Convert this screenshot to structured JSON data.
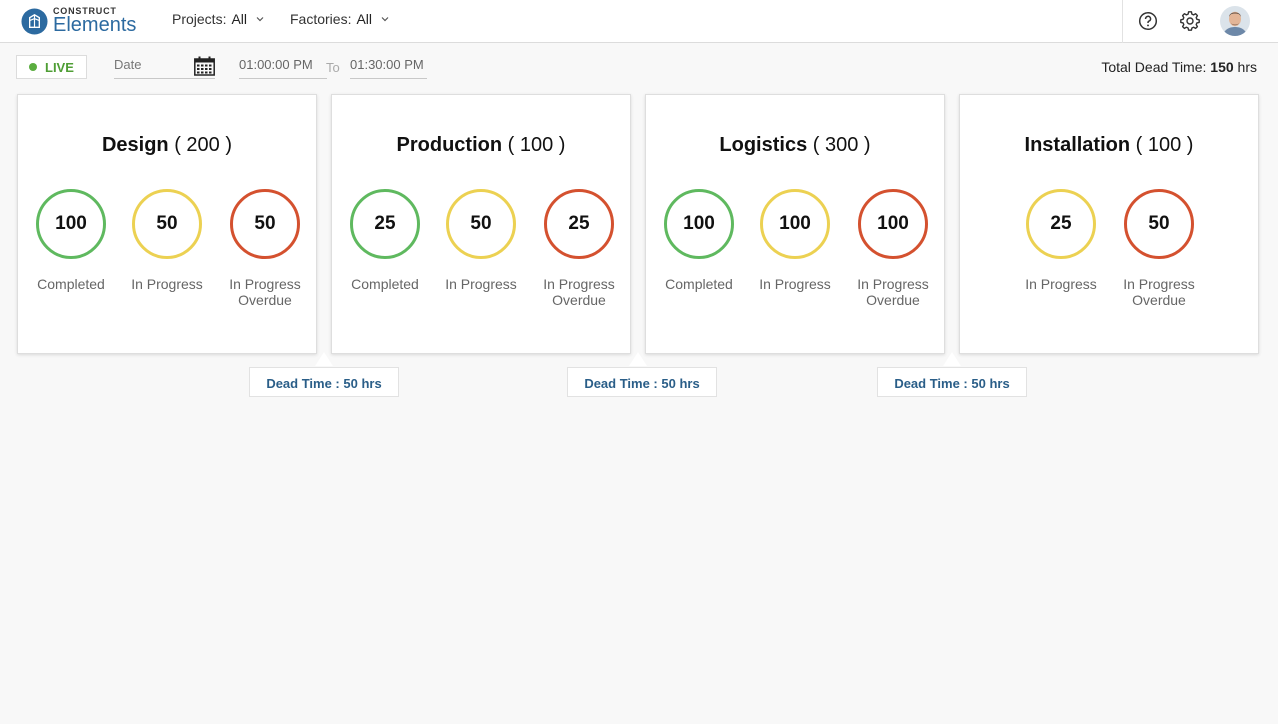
{
  "brand": {
    "top": "CONSTRUCT",
    "bottom": "Elements",
    "color": "#2c6aa0"
  },
  "filters": [
    {
      "label": "Projects:",
      "value": "All"
    },
    {
      "label": "Factories:",
      "value": "All"
    }
  ],
  "header_icons": [
    "help-icon",
    "settings-icon",
    "user-avatar"
  ],
  "toolbar": {
    "live_label": "LIVE",
    "date_placeholder": "Date",
    "time_from": "01:00:00 PM",
    "to_label": "To",
    "time_to": "01:30:00 PM",
    "total_label": "Total Dead Time:",
    "total_value": "150",
    "total_unit": "hrs"
  },
  "stages": [
    {
      "name": "Design",
      "count": "( 200 )",
      "metrics": [
        {
          "value": "100",
          "label": "Completed",
          "status": "green"
        },
        {
          "value": "50",
          "label": "In Progress",
          "status": "yellow"
        },
        {
          "value": "50",
          "label": "In Progress Overdue",
          "status": "red"
        }
      ]
    },
    {
      "name": "Production",
      "count": "( 100 )",
      "metrics": [
        {
          "value": "25",
          "label": "Completed",
          "status": "green"
        },
        {
          "value": "50",
          "label": "In Progress",
          "status": "yellow"
        },
        {
          "value": "25",
          "label": "In Progress Overdue",
          "status": "red"
        }
      ]
    },
    {
      "name": "Logistics",
      "count": "( 300 )",
      "metrics": [
        {
          "value": "100",
          "label": "Completed",
          "status": "green"
        },
        {
          "value": "100",
          "label": "In Progress",
          "status": "yellow"
        },
        {
          "value": "100",
          "label": "In Progress Overdue",
          "status": "red"
        }
      ]
    },
    {
      "name": "Installation",
      "count": "( 100 )",
      "metrics": [
        {
          "value": "25",
          "label": "In Progress",
          "status": "yellow"
        },
        {
          "value": "50",
          "label": "In Progress Overdue",
          "status": "red"
        }
      ]
    }
  ],
  "dead_times": [
    {
      "label": "Dead Time : 50 hrs"
    },
    {
      "label": "Dead Time : 50 hrs"
    },
    {
      "label": "Dead Time : 50 hrs"
    }
  ],
  "colors": {
    "completed": "#5fb95f",
    "in_progress": "#ecd152",
    "overdue": "#d4512f",
    "live": "#4f9e35",
    "accent": "#2a5e88"
  }
}
